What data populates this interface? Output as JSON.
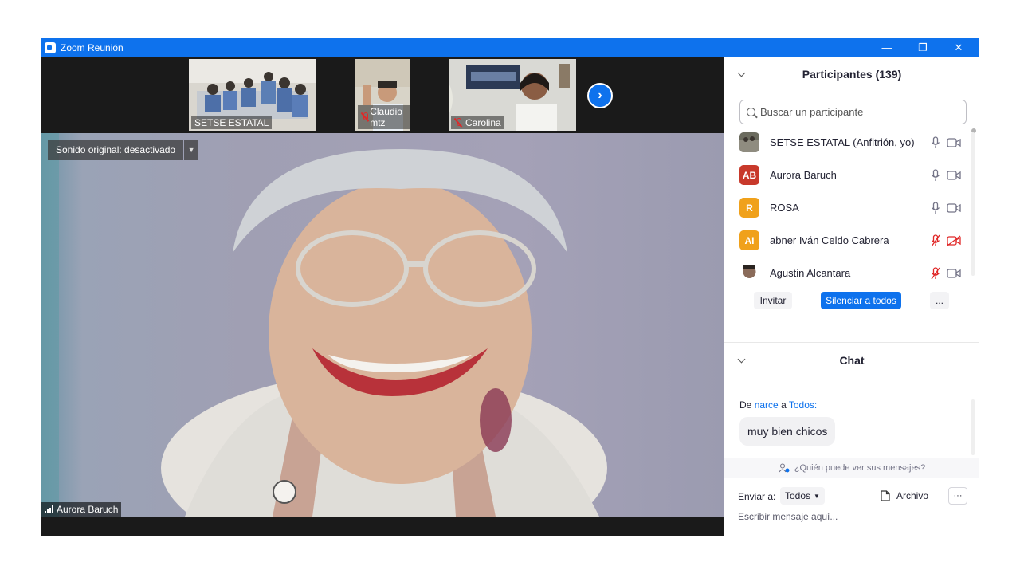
{
  "window": {
    "title": "Zoom Reunión",
    "minimize": "—",
    "restore": "❐",
    "close": "✕"
  },
  "thumbnails": [
    {
      "name": "SETSE ESTATAL",
      "muted": false
    },
    {
      "name": "Claudio mtz",
      "muted": true
    },
    {
      "name": "Carolina",
      "muted": true
    }
  ],
  "main": {
    "audio_label": "Sonido original: desactivado",
    "speaker": "Aurora Baruch"
  },
  "participants": {
    "header": "Participantes (139)",
    "search_placeholder": "Buscar un participante",
    "list": [
      {
        "name": "SETSE ESTATAL (Anfitrión, yo)",
        "initials": "",
        "color": "#6b6b5e",
        "mic_muted": false,
        "cam_off": false
      },
      {
        "name": "Aurora Baruch",
        "initials": "AB",
        "color": "#c8392b",
        "mic_muted": false,
        "cam_off": false
      },
      {
        "name": "ROSA",
        "initials": "R",
        "color": "#f0a11b",
        "mic_muted": false,
        "cam_off": false
      },
      {
        "name": "abner Iván Celdo Cabrera",
        "initials": "AI",
        "color": "#f0a11b",
        "mic_muted": true,
        "cam_off": true
      },
      {
        "name": "Agustin Alcantara",
        "initials": "",
        "color": "#8a6b5a",
        "mic_muted": true,
        "cam_off": false
      }
    ],
    "invite": "Invitar",
    "mute_all": "Silenciar a todos",
    "more": "..."
  },
  "chat": {
    "header": "Chat",
    "from_prefix": "De",
    "from_user": "narce",
    "from_mid": "a",
    "from_target": "Todos:",
    "message": "muy bien chicos",
    "who_can_see": "¿Quién puede ver sus mensajes?",
    "send_to_label": "Enviar a:",
    "send_to_value": "Todos",
    "file": "Archivo",
    "more": "···",
    "input_placeholder": "Escribir mensaje aquí..."
  }
}
